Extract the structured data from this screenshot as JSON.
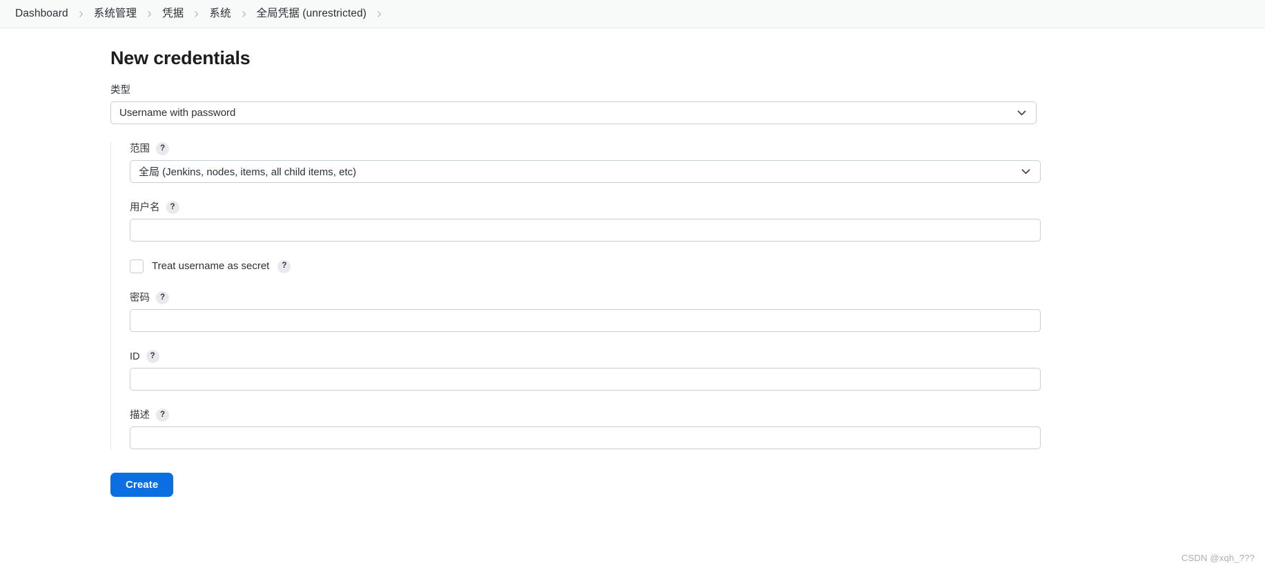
{
  "breadcrumb": {
    "items": [
      {
        "label": "Dashboard"
      },
      {
        "label": "系统管理"
      },
      {
        "label": "凭据"
      },
      {
        "label": "系统"
      },
      {
        "label": "全局凭据 (unrestricted)"
      }
    ],
    "separator_icon": "chevron-right-icon",
    "trailing_separator": true
  },
  "page": {
    "title": "New credentials"
  },
  "form": {
    "type": {
      "label": "类型",
      "value": "Username with password",
      "chevron_icon": "chevron-down-icon"
    },
    "scope": {
      "label": "范围",
      "help": "?",
      "value": "全局 (Jenkins, nodes, items, all child items, etc)",
      "chevron_icon": "chevron-down-icon"
    },
    "username": {
      "label": "用户名",
      "help": "?",
      "value": "",
      "placeholder": ""
    },
    "treat_username_as_secret": {
      "label": "Treat username as secret",
      "help": "?",
      "checked": false
    },
    "password": {
      "label": "密码",
      "help": "?",
      "value": "",
      "placeholder": ""
    },
    "id": {
      "label": "ID",
      "help": "?",
      "value": "",
      "placeholder": ""
    },
    "description": {
      "label": "描述",
      "help": "?",
      "value": "",
      "placeholder": ""
    }
  },
  "actions": {
    "create_label": "Create"
  },
  "watermark": {
    "text": "CSDN @xqh_???"
  },
  "colors": {
    "accent": "#0b6fe1",
    "breadcrumb_bg": "#f8f9f9",
    "border": "#c6ced4",
    "help_badge_bg": "#e8e9ec"
  }
}
